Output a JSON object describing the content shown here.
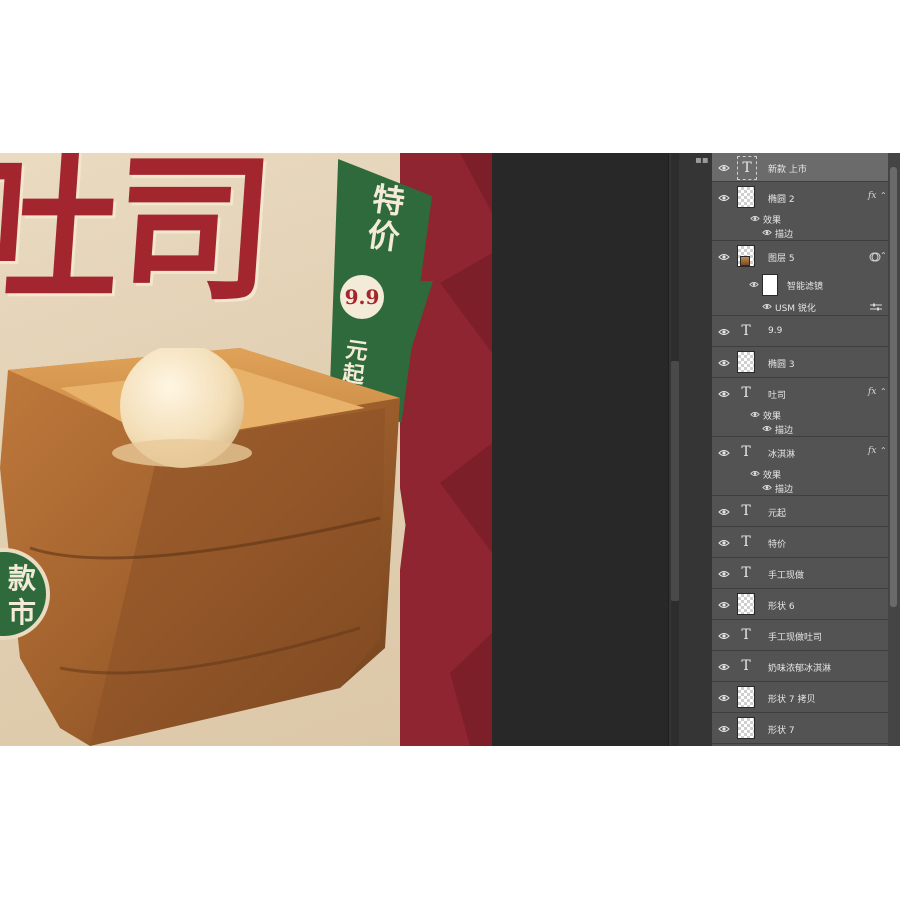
{
  "poster": {
    "title_chars": "吐司",
    "banner_line1": "特价",
    "price": "9.9",
    "banner_line2": "元起",
    "badge_text": "款\n市"
  },
  "layers": [
    {
      "name": "新款 上市",
      "kind": "text",
      "selected": true
    },
    {
      "name": "椭圆 2",
      "kind": "shape",
      "fx": "fx",
      "effects_label": "效果",
      "stroke_label": "描边"
    },
    {
      "name": "图层 5",
      "kind": "smart",
      "filters_label": "智能滤镜",
      "filter_name": "USM 锐化"
    },
    {
      "name": "9.9",
      "kind": "text"
    },
    {
      "name": "椭圆 3",
      "kind": "shape"
    },
    {
      "name": "吐司",
      "kind": "text",
      "fx": "fx",
      "effects_label": "效果",
      "stroke_label": "描边"
    },
    {
      "name": "冰淇淋",
      "kind": "text",
      "fx": "fx",
      "effects_label": "效果",
      "stroke_label": "描边"
    },
    {
      "name": "元起",
      "kind": "text"
    },
    {
      "name": "特价",
      "kind": "text"
    },
    {
      "name": "手工现做",
      "kind": "text"
    },
    {
      "name": "形状 6",
      "kind": "shape"
    },
    {
      "name": "手工现做吐司",
      "kind": "text"
    },
    {
      "name": "奶味浓郁冰淇淋",
      "kind": "text"
    },
    {
      "name": "形状 7 拷贝",
      "kind": "shape"
    },
    {
      "name": "形状 7",
      "kind": "shape"
    }
  ],
  "colors": {
    "poster_red": "#a3262e",
    "poster_green": "#2f6a3c",
    "paper": "#e2d0b3",
    "panel_bg": "#535353",
    "workspace_bg": "#282828"
  }
}
